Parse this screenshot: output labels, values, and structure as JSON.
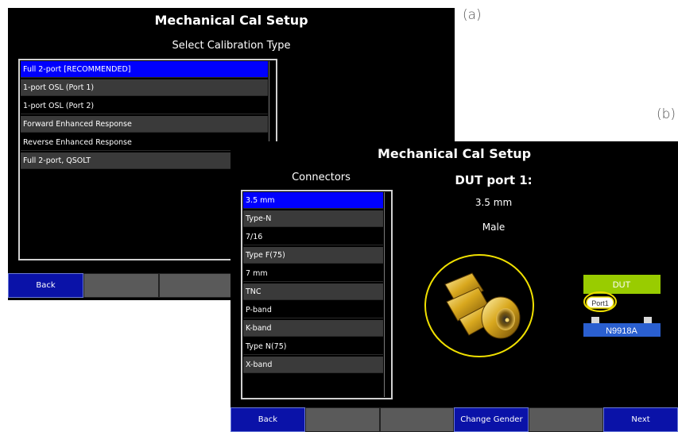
{
  "labels": {
    "a": "(a)",
    "b": "(b)"
  },
  "screen_a": {
    "title": "Mechanical Cal Setup",
    "subtitle": "Select Calibration Type",
    "items": [
      "Full 2-port [RECOMMENDED]",
      "1-port OSL (Port 1)",
      "1-port OSL (Port 2)",
      "Forward Enhanced Response",
      "Reverse Enhanced Response",
      "Full 2-port, QSOLT"
    ],
    "selected_index": 0,
    "softkeys": [
      "Back",
      "",
      ""
    ]
  },
  "screen_b": {
    "title": "Mechanical Cal Setup",
    "connectors_heading": "Connectors",
    "connectors": [
      "3.5 mm",
      "Type-N",
      "7/16",
      "Type F(75)",
      "7 mm",
      "TNC",
      "P-band",
      "K-band",
      "Type N(75)",
      "X-band"
    ],
    "selected_index": 0,
    "dut_port_label": "DUT port 1:",
    "connector_type": "3.5 mm",
    "gender": "Male",
    "diagram": {
      "dut": "DUT",
      "port": "Port1",
      "instrument": "N9918A"
    },
    "softkeys": [
      "Back",
      "",
      "",
      "Change Gender",
      "",
      "Next"
    ]
  },
  "colors": {
    "selection": "#0000ff",
    "softkey_blue": "#0a12a8",
    "dut_green": "#99cc00",
    "instrument_blue": "#2a5fd0",
    "highlight_yellow": "#f0e000"
  }
}
